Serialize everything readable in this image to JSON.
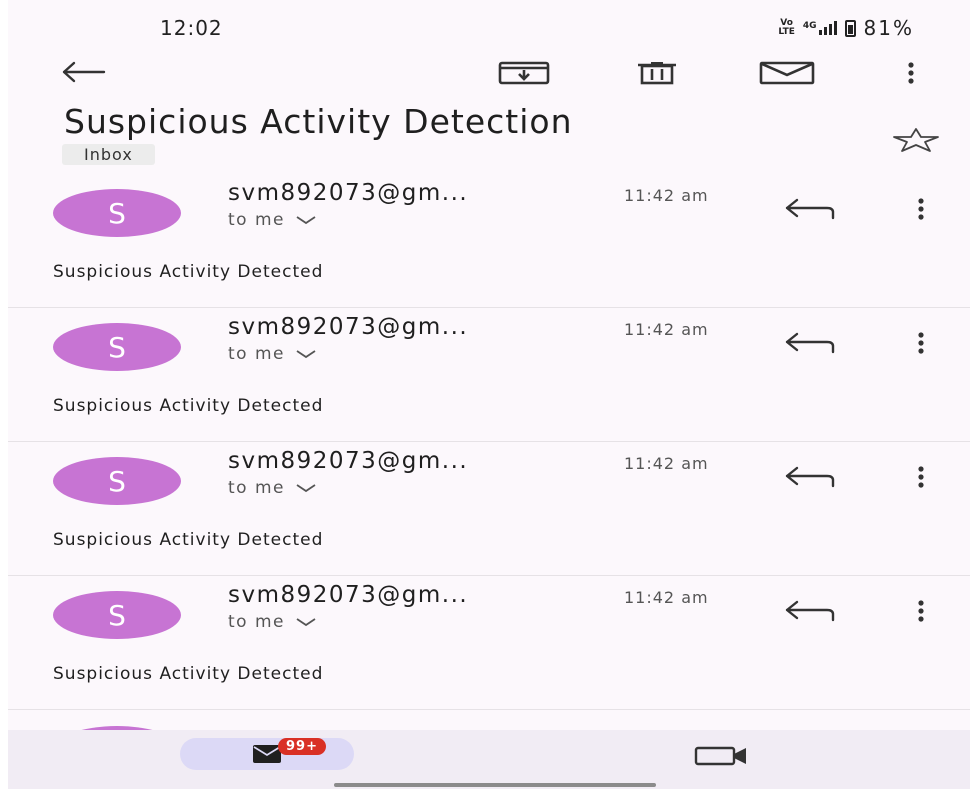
{
  "status_bar": {
    "time": "12:02",
    "volte_top": "Vo",
    "volte_bottom": "LTE",
    "network": "4G",
    "battery": "81%"
  },
  "toolbar": {
    "back_icon": "arrow-back-icon",
    "archive_icon": "archive-icon",
    "delete_icon": "trash-icon",
    "mark_unread_icon": "mail-icon",
    "more_icon": "more-vert-icon"
  },
  "email": {
    "subject": "Suspicious Activity Detection",
    "label": "Inbox",
    "starred": false
  },
  "messages": [
    {
      "avatar_letter": "S",
      "sender": "svm892073@gm...",
      "recipient": "to me",
      "time": "11:42 am",
      "snippet": "Suspicious Activity Detected"
    },
    {
      "avatar_letter": "S",
      "sender": "svm892073@gm...",
      "recipient": "to me",
      "time": "11:42 am",
      "snippet": "Suspicious Activity Detected"
    },
    {
      "avatar_letter": "S",
      "sender": "svm892073@gm...",
      "recipient": "to me",
      "time": "11:42 am",
      "snippet": "Suspicious Activity Detected"
    },
    {
      "avatar_letter": "S",
      "sender": "svm892073@gm...",
      "recipient": "to me",
      "time": "11:42 am",
      "snippet": "Suspicious Activity Detected"
    }
  ],
  "bottom_nav": {
    "mail_badge": "99+",
    "mail_icon": "mail-filled-icon",
    "meet_icon": "video-camera-icon"
  },
  "colors": {
    "avatar": "#c774d3",
    "background": "#fcf8fc",
    "nav_active": "#dcd9f6",
    "badge": "#d93025"
  }
}
